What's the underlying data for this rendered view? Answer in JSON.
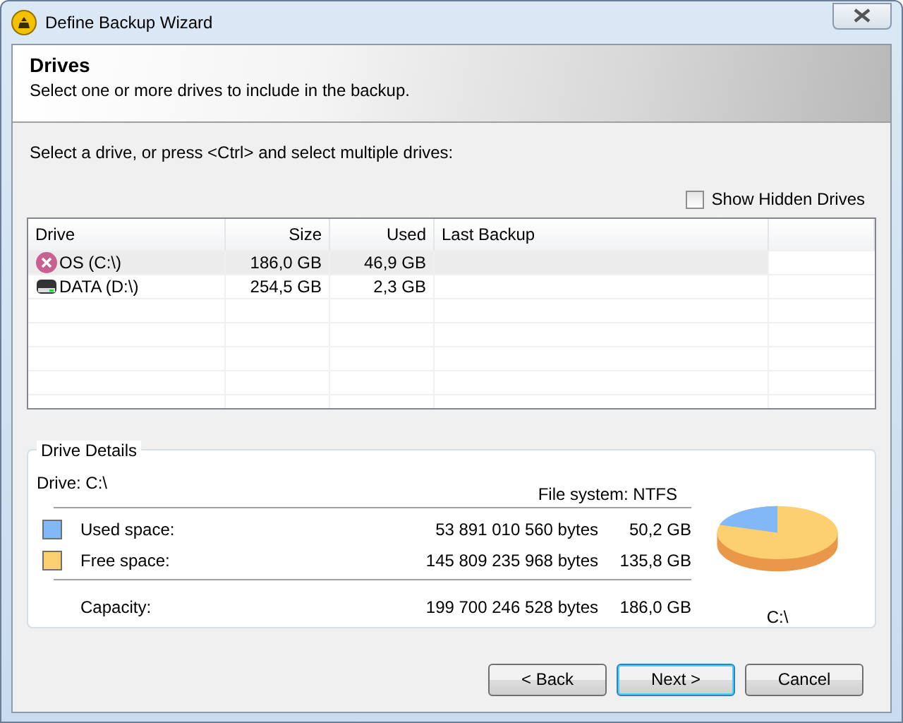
{
  "window": {
    "title": "Define Backup Wizard"
  },
  "header": {
    "title": "Drives",
    "subtitle": "Select one or more drives to include in the backup."
  },
  "instruction": "Select a drive, or press <Ctrl> and select multiple drives:",
  "show_hidden_drives": {
    "label": "Show Hidden Drives",
    "checked": false
  },
  "table": {
    "columns": [
      "Drive",
      "Size",
      "Used",
      "Last Backup"
    ],
    "rows": [
      {
        "kind": "error",
        "drive": "OS (C:\\)",
        "size": "186,0 GB",
        "used": "46,9 GB",
        "selected": true
      },
      {
        "kind": "disk",
        "drive": "DATA (D:\\)",
        "size": "254,5 GB",
        "used": "2,3 GB",
        "selected": false
      }
    ]
  },
  "details": {
    "title": "Drive Details",
    "drive": "Drive: C:\\",
    "file_system": "File system: NTFS",
    "items": [
      {
        "label": "Used space:",
        "bytes": "53 891 010 560 bytes",
        "size": "50,2 GB",
        "color": "#80b8f8"
      },
      {
        "label": "Free space:",
        "bytes": "145 809 235 968 bytes",
        "size": "135,8 GB",
        "color": "#fcd070"
      }
    ],
    "capacity": {
      "label": "Capacity:",
      "bytes": "199 700 246 528 bytes",
      "size": "186,0 GB"
    },
    "pie_label": "C:\\"
  },
  "buttons": [
    {
      "label": "< Back",
      "default": false
    },
    {
      "label": "Next >",
      "default": true
    },
    {
      "label": "Cancel",
      "default": false
    }
  ]
}
